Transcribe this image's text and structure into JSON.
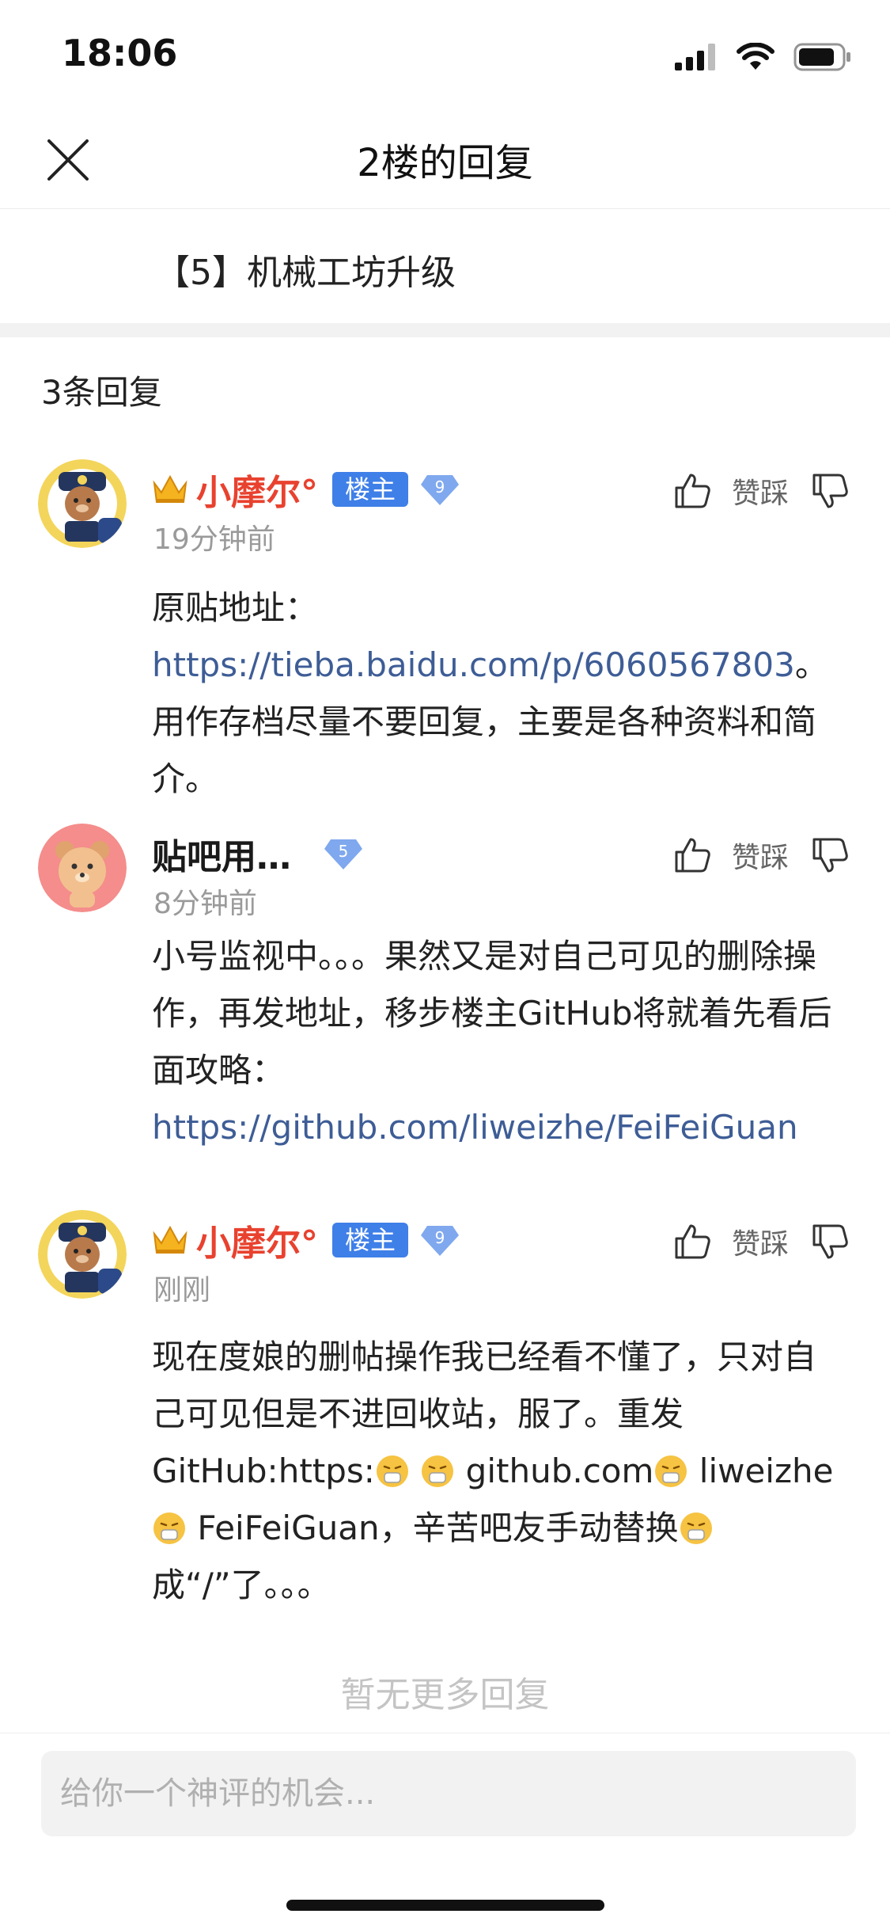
{
  "status_bar": {
    "time": "18:06"
  },
  "nav": {
    "title": "2楼的回复"
  },
  "thread": {
    "title": "【5】机械工坊升级"
  },
  "reply_count": "3条回复",
  "vote_label": "赞踩",
  "comments": [
    {
      "username": "小摩尔°",
      "badge": "楼主",
      "level": "9",
      "time": "19分钟前",
      "text_before": "原贴地址：",
      "link": "https://tieba.baidu.com/p/6060567803",
      "text_after": "。用作存档尽量不要回复，主要是各种资料和简介。"
    },
    {
      "username": "贴吧用…",
      "level": "5",
      "time": "8分钟前",
      "text_before": "小号监视中。。。果然又是对自己可见的删除操作，再发地址，移步楼主GitHub将就着先看后面攻略：",
      "link": "https://github.com/liweizhe/FeiFeiGuan"
    },
    {
      "username": "小摩尔°",
      "badge": "楼主",
      "level": "9",
      "time": "刚刚",
      "text_part1": "现在度娘的删帖操作我已经看不懂了，只对自己可见但是不进回收站，服了。重发GitHub:https:",
      "text_part2": "github.com",
      "text_part3": "liweizhe",
      "text_part4": "FeiFeiGuan，辛苦吧友手动替换",
      "text_part5": "成“/”了。。。"
    }
  ],
  "no_more": "暂无更多回复",
  "input": {
    "placeholder": "给你一个神评的机会..."
  },
  "colors": {
    "accent_red": "#e8422f",
    "badge_blue": "#3f7fe8",
    "link": "#3e5d96"
  }
}
